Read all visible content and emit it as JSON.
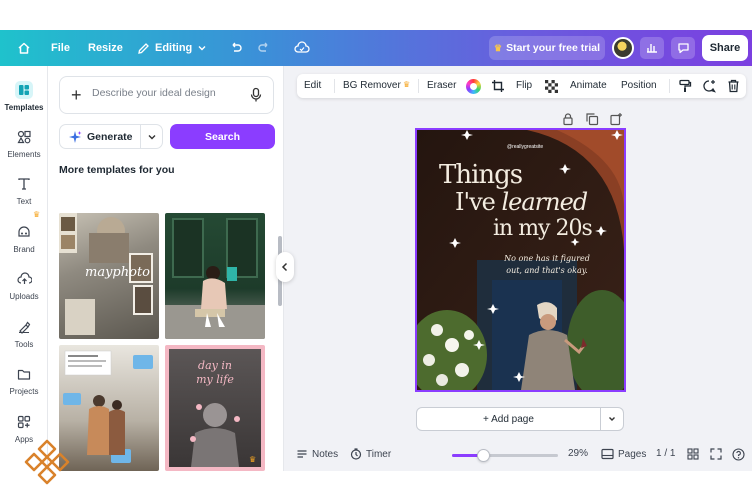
{
  "topbar": {
    "file": "File",
    "resize": "Resize",
    "editing": "Editing",
    "trial": "Start your free trial",
    "share": "Share"
  },
  "rail": {
    "items": [
      {
        "label": "Templates",
        "icon": "templates-icon"
      },
      {
        "label": "Elements",
        "icon": "elements-icon"
      },
      {
        "label": "Text",
        "icon": "text-icon"
      },
      {
        "label": "Brand",
        "icon": "brand-icon"
      },
      {
        "label": "Uploads",
        "icon": "uploads-icon"
      },
      {
        "label": "Tools",
        "icon": "tools-icon"
      },
      {
        "label": "Projects",
        "icon": "projects-icon"
      },
      {
        "label": "Apps",
        "icon": "apps-icon"
      }
    ]
  },
  "panel": {
    "placeholder": "Describe your ideal design",
    "generate": "Generate",
    "search": "Search",
    "more_title": "More templates for you",
    "thumb1_text": "mayphoto",
    "thumb4_text1": "day in",
    "thumb4_text2": "my life"
  },
  "toolbar": {
    "edit": "Edit",
    "bg_remover": "BG Remover",
    "eraser": "Eraser",
    "flip": "Flip",
    "animate": "Animate",
    "position": "Position"
  },
  "design": {
    "handle": "@reallygreatsite",
    "line1": "Things",
    "line2a": "I've",
    "line2b": "learned",
    "line3": "in my 20s",
    "sub1": "No one has it figured",
    "sub2": "out, and that's okay."
  },
  "add_page": "+ Add page",
  "footer": {
    "notes": "Notes",
    "timer": "Timer",
    "zoom": "29%",
    "zoom_level": 0.29,
    "pages": "Pages",
    "page_count": "1 / 1"
  },
  "colors": {
    "accent": "#8b3dff",
    "topbar_start": "#1fc2cc",
    "topbar_end": "#7b3fe0"
  }
}
